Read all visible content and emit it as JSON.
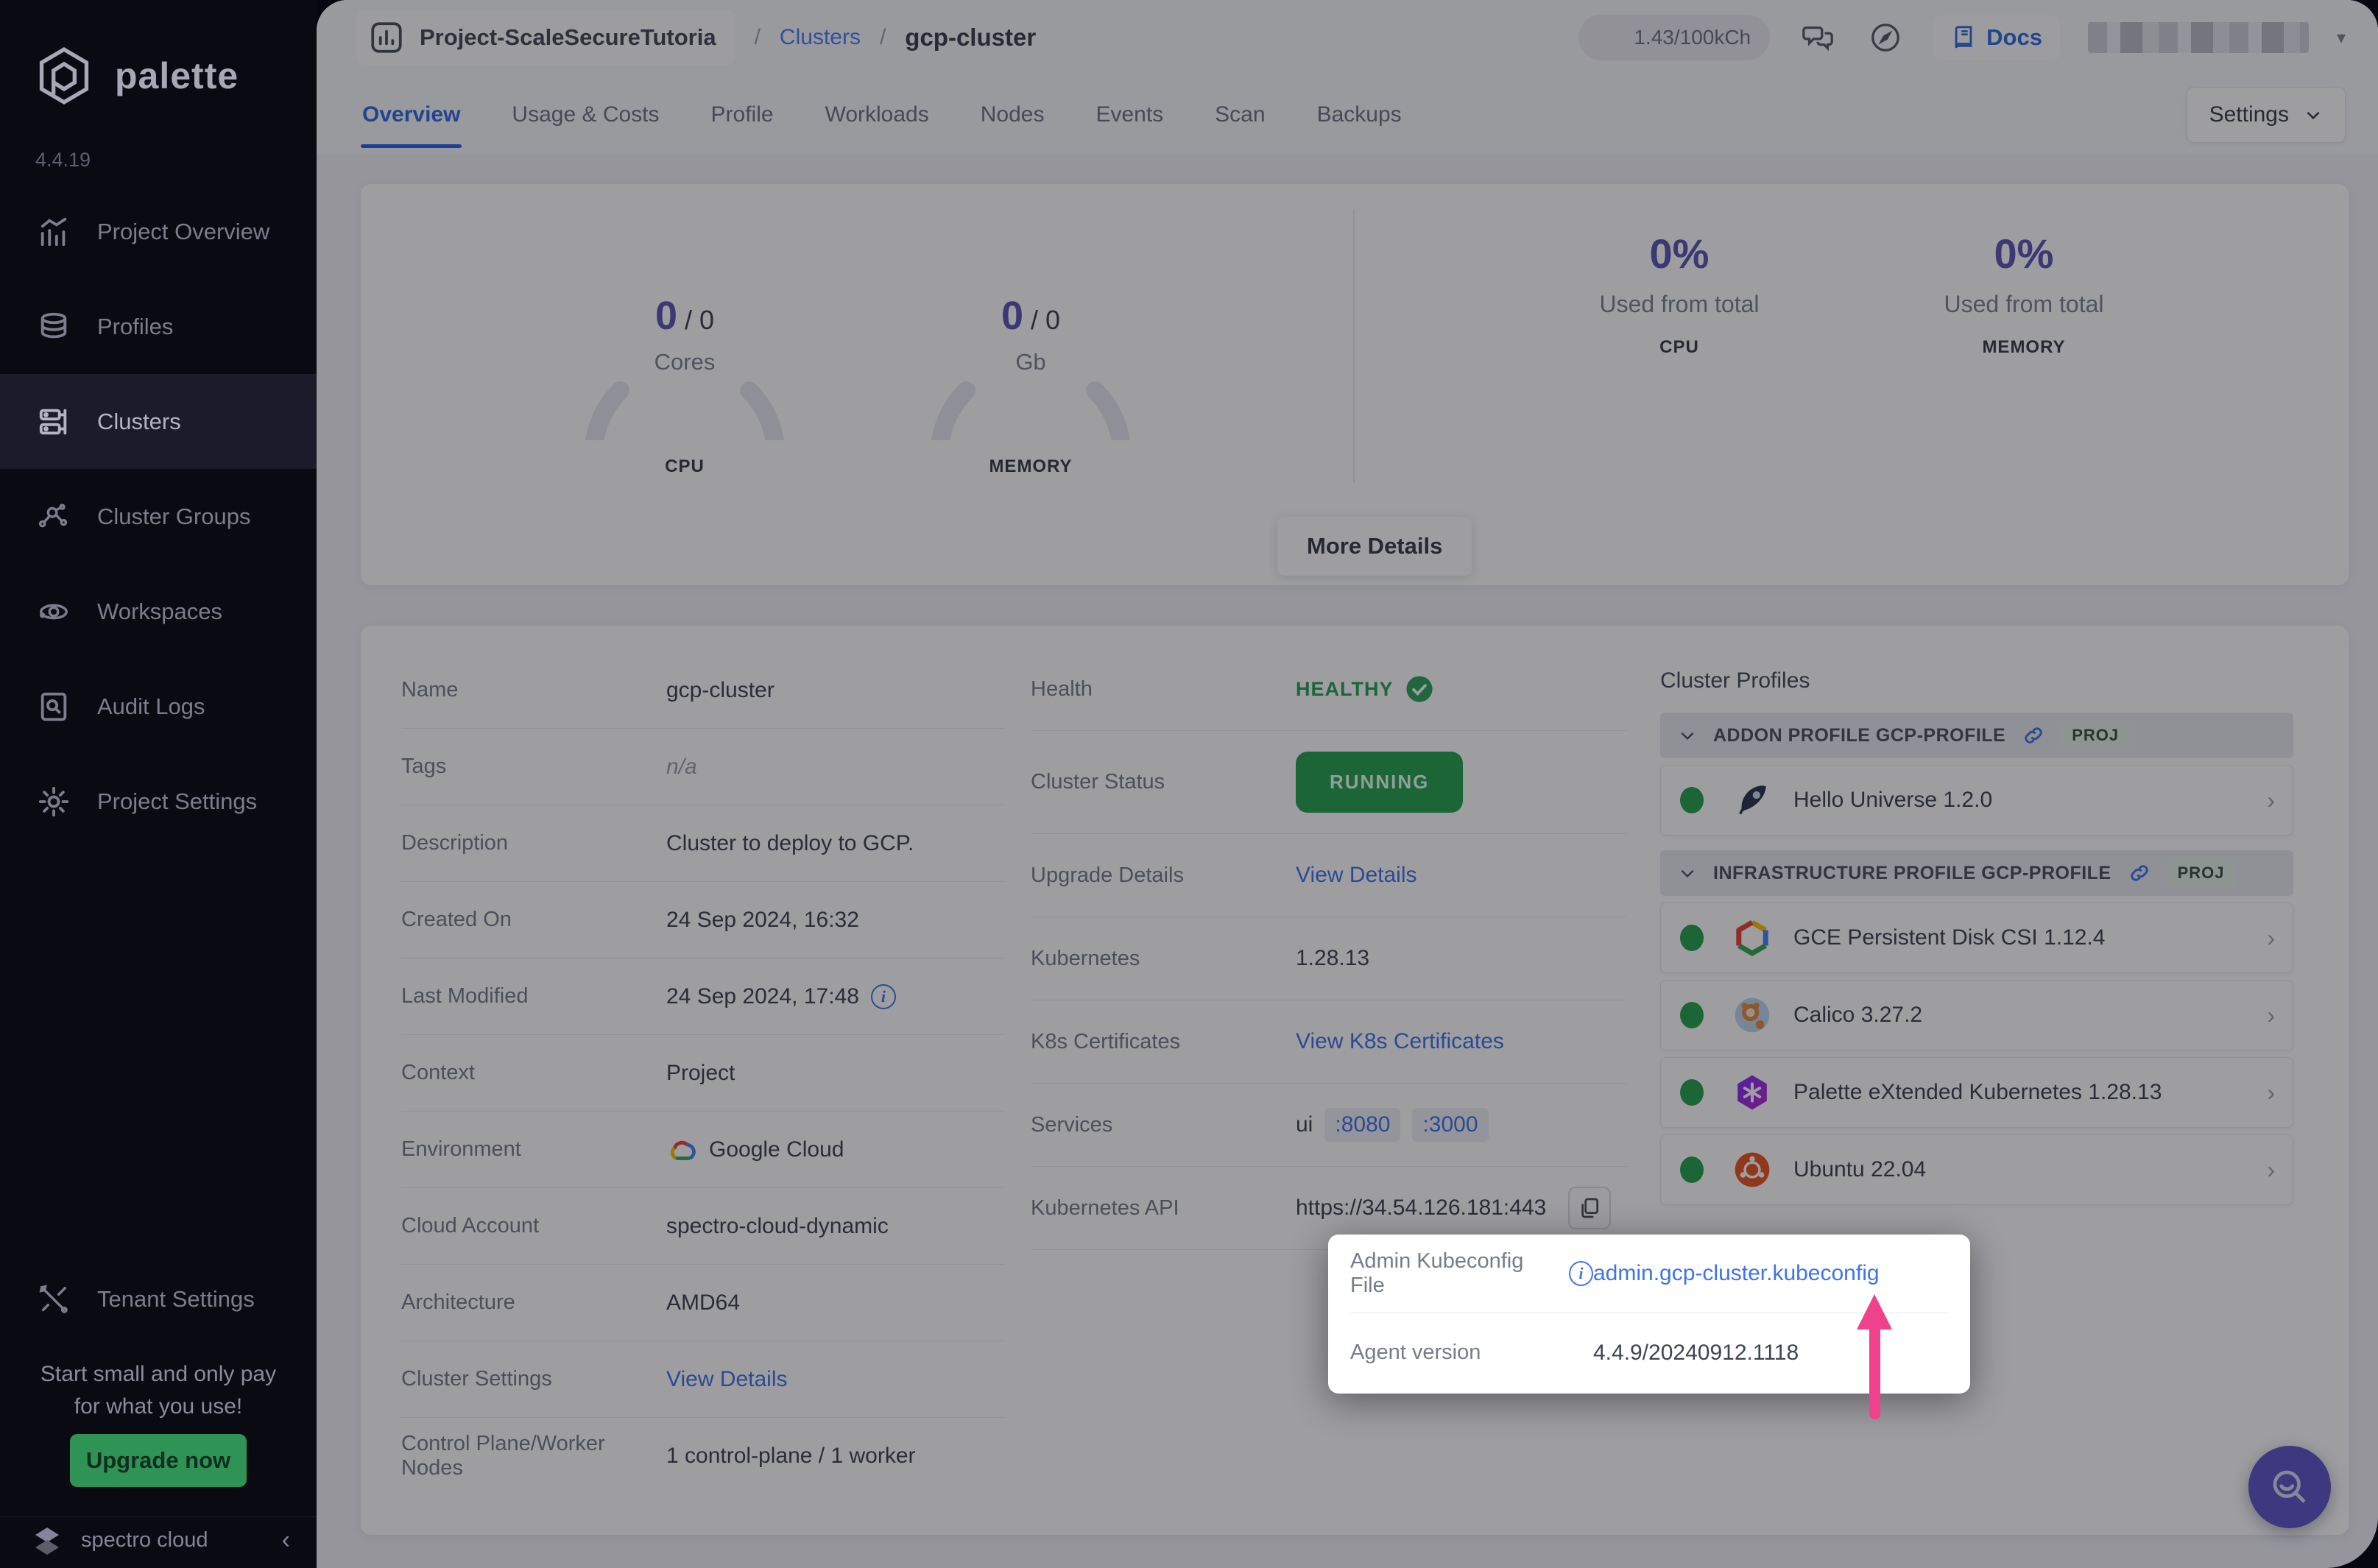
{
  "sidebar": {
    "logo_text": "palette",
    "version": "4.4.19",
    "items": [
      {
        "label": "Project Overview"
      },
      {
        "label": "Profiles"
      },
      {
        "label": "Clusters"
      },
      {
        "label": "Cluster Groups"
      },
      {
        "label": "Workspaces"
      },
      {
        "label": "Audit Logs"
      },
      {
        "label": "Project Settings"
      }
    ],
    "tenant_settings_label": "Tenant Settings",
    "promo_line1": "Start small and only pay",
    "promo_line2": "for what you use!",
    "upgrade_label": "Upgrade now",
    "brand": "spectro cloud"
  },
  "topbar": {
    "project": "Project-ScaleSecureTutoria",
    "breadcrumb_sep": "/",
    "breadcrumb_link": "Clusters",
    "breadcrumb_current": "gcp-cluster",
    "credits": "1.43/100kCh",
    "docs_label": "Docs"
  },
  "tabs": {
    "items": [
      "Overview",
      "Usage & Costs",
      "Profile",
      "Workloads",
      "Nodes",
      "Events",
      "Scan",
      "Backups"
    ],
    "active": "Overview",
    "settings_label": "Settings"
  },
  "overview": {
    "gauges": [
      {
        "value": "0",
        "sep": "/",
        "total": "0",
        "unit": "Cores",
        "metric": "CPU"
      },
      {
        "value": "0",
        "sep": "/",
        "total": "0",
        "unit": "Gb",
        "metric": "MEMORY"
      }
    ],
    "usage": [
      {
        "pct": "0%",
        "caption": "Used from total",
        "metric": "CPU"
      },
      {
        "pct": "0%",
        "caption": "Used from total",
        "metric": "MEMORY"
      }
    ],
    "more_details_label": "More Details"
  },
  "details": {
    "left": [
      {
        "label": "Name",
        "value": "gcp-cluster"
      },
      {
        "label": "Tags",
        "value": "n/a"
      },
      {
        "label": "Description",
        "value": "Cluster to deploy to GCP."
      },
      {
        "label": "Created On",
        "value": "24 Sep 2024, 16:32"
      },
      {
        "label": "Last Modified",
        "value": "24 Sep 2024, 17:48"
      },
      {
        "label": "Context",
        "value": "Project"
      },
      {
        "label": "Environment",
        "value": "Google Cloud"
      },
      {
        "label": "Cloud Account",
        "value": "spectro-cloud-dynamic"
      },
      {
        "label": "Architecture",
        "value": "AMD64"
      },
      {
        "label": "Cluster Settings",
        "value": "View Details"
      },
      {
        "label": "Control Plane/Worker Nodes",
        "value": "1 control-plane / 1 worker"
      }
    ],
    "middle": [
      {
        "label": "Health",
        "value": "HEALTHY"
      },
      {
        "label": "Cluster Status",
        "value": "RUNNING"
      },
      {
        "label": "Upgrade Details",
        "value": "View Details"
      },
      {
        "label": "Kubernetes",
        "value": "1.28.13"
      },
      {
        "label": "K8s Certificates",
        "value": "View K8s Certificates"
      },
      {
        "label": "Services",
        "value": "ui",
        "ports": [
          ":8080",
          ":3000"
        ]
      },
      {
        "label": "Kubernetes API",
        "value": "https://34.54.126.181:443"
      }
    ],
    "highlight": {
      "kubeconfig_label": "Admin Kubeconfig File",
      "kubeconfig_value": "admin.gcp-cluster.kubeconfig",
      "agent_label": "Agent version",
      "agent_value": "4.4.9/20240912.1118"
    }
  },
  "profiles": {
    "title": "Cluster Profiles",
    "groups": [
      {
        "header": "ADDON PROFILE GCP-PROFILE",
        "badge": "PROJ",
        "items": [
          {
            "name": "Hello Universe 1.2.0"
          }
        ]
      },
      {
        "header": "INFRASTRUCTURE PROFILE GCP-PROFILE",
        "badge": "PROJ",
        "items": [
          {
            "name": "GCE Persistent Disk CSI 1.12.4"
          },
          {
            "name": "Calico 3.27.2"
          },
          {
            "name": "Palette eXtended Kubernetes 1.28.13"
          },
          {
            "name": "Ubuntu 22.04"
          }
        ]
      }
    ]
  },
  "colors": {
    "accent_blue": "#3f74e8",
    "brand_purple": "#5b55b4",
    "success_green": "#27a04f",
    "arrow_pink": "#f0418c",
    "sidebar_bg": "#0a0a13"
  }
}
